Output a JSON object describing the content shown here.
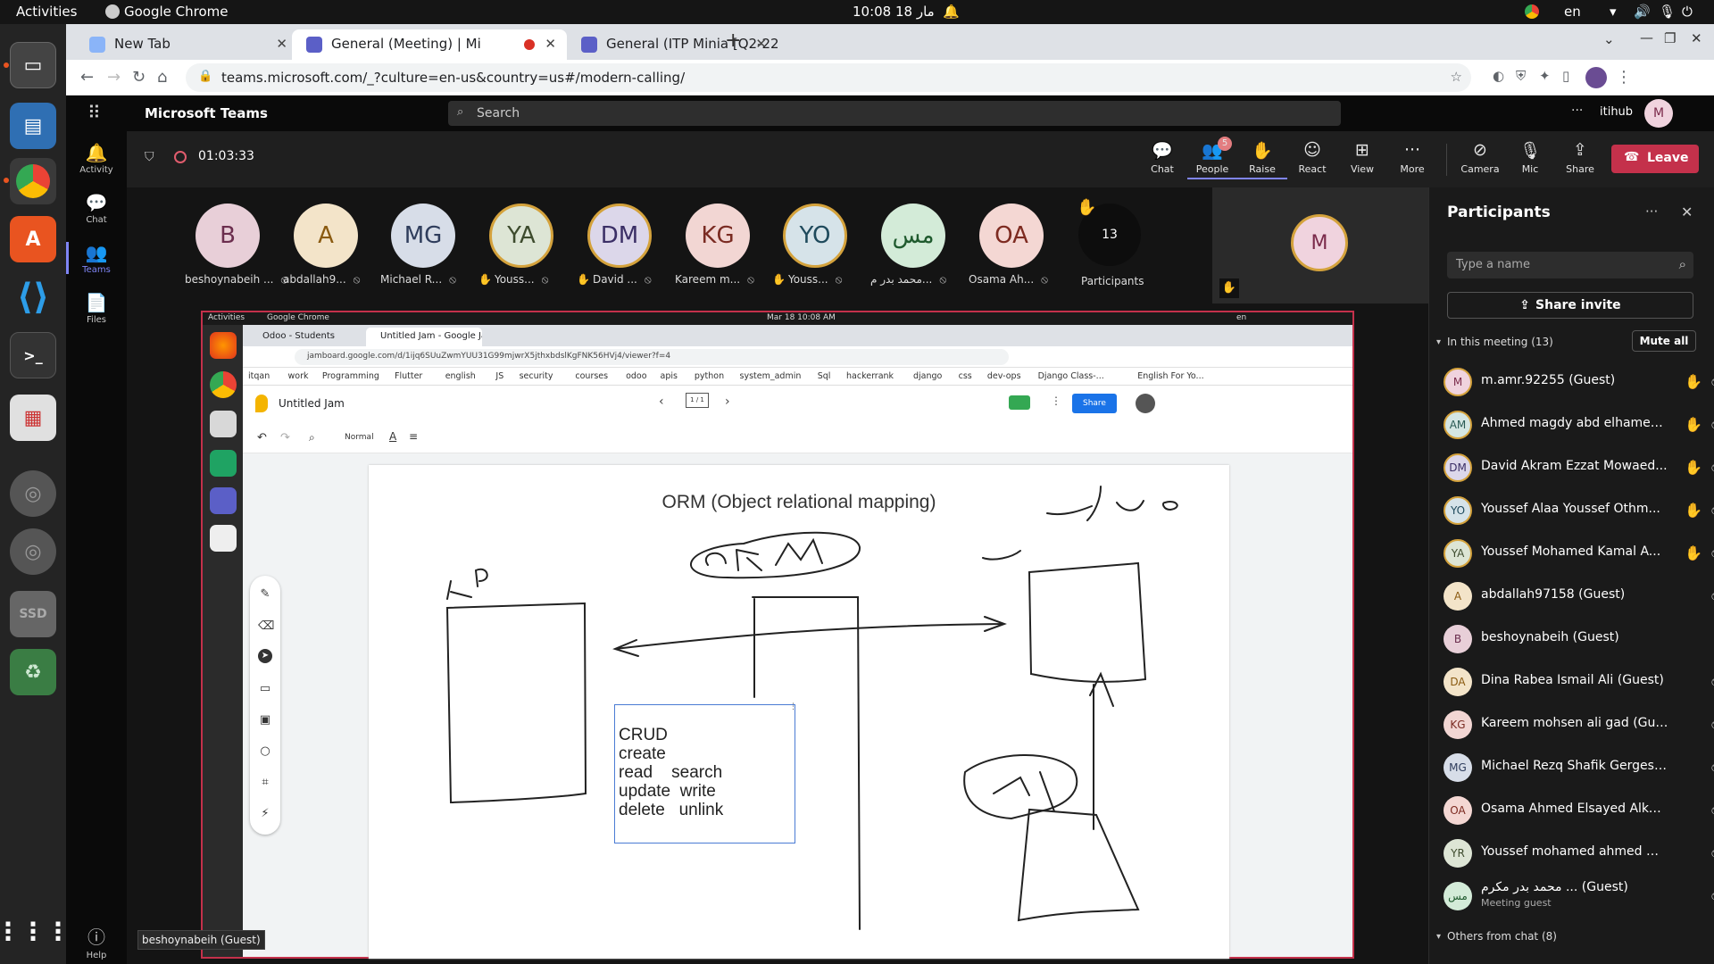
{
  "topbar": {
    "activities": "Activities",
    "app": "Google Chrome",
    "clock": "10:08  18 مار",
    "lang": "en"
  },
  "chrome": {
    "tabs": [
      {
        "title": "New Tab"
      },
      {
        "title": "General (Meeting) | Mi"
      },
      {
        "title": "General (ITP Minia [Q2-22"
      }
    ],
    "url": "teams.microsoft.com/_?culture=en-us&country=us#/modern-calling/"
  },
  "teams": {
    "brand": "Microsoft Teams",
    "search_placeholder": "Search",
    "more": "···",
    "org": "itihub",
    "me_initial": "M",
    "rail": [
      {
        "label": "Activity",
        "icon": "bell-icon"
      },
      {
        "label": "Chat",
        "icon": "chat-icon"
      },
      {
        "label": "Teams",
        "icon": "teams-icon"
      },
      {
        "label": "Files",
        "icon": "files-icon"
      },
      {
        "label": "Help",
        "icon": "help-icon"
      }
    ],
    "timer": "01:03:33",
    "controls": [
      {
        "label": "Chat",
        "icon": "chat-icon"
      },
      {
        "label": "People",
        "icon": "people-icon",
        "badge": "5"
      },
      {
        "label": "Raise",
        "icon": "hand-icon"
      },
      {
        "label": "React",
        "icon": "smile-icon"
      },
      {
        "label": "View",
        "icon": "grid-icon"
      },
      {
        "label": "More",
        "icon": "more-icon"
      },
      {
        "label": "Camera",
        "icon": "camera-off-icon"
      },
      {
        "label": "Mic",
        "icon": "mic-off-icon"
      },
      {
        "label": "Share",
        "icon": "share-icon"
      }
    ],
    "leave": "Leave",
    "gallery": [
      {
        "initials": "B",
        "name": "beshoynabeih ...",
        "bg": "#e8cfd8",
        "fg": "#6b2e4e"
      },
      {
        "initials": "A",
        "name": "abdallah9...",
        "bg": "#f3e4c9",
        "fg": "#8a5a10"
      },
      {
        "initials": "MG",
        "name": "Michael R...",
        "bg": "#d7dde8",
        "fg": "#2f3d5c"
      },
      {
        "initials": "YA",
        "name": "Youss...",
        "bg": "#dde5d5",
        "fg": "#3d4b2d",
        "hand": true
      },
      {
        "initials": "DM",
        "name": "David ...",
        "bg": "#dcd7ea",
        "fg": "#3b2f66",
        "hand": true
      },
      {
        "initials": "KG",
        "name": "Kareem m...",
        "bg": "#f2d6d3",
        "fg": "#7a2b22"
      },
      {
        "initials": "YO",
        "name": "Youss...",
        "bg": "#d6e3e9",
        "fg": "#1f4a5c",
        "hand": true
      },
      {
        "initials": "مس",
        "name": "محمد بدر م...",
        "bg": "#d3ebd8",
        "fg": "#1f5a2e"
      },
      {
        "initials": "OA",
        "name": "Osama Ah...",
        "bg": "#f4d7d3",
        "fg": "#7d2a20"
      }
    ],
    "overflow_count": "13",
    "overflow_label": "Participants",
    "tile_initial": "M",
    "hover_name": "beshoynabeih (Guest)"
  },
  "panel": {
    "title": "Participants",
    "search_placeholder": "Type a name",
    "share_invite": "Share invite",
    "in_meeting": "In this meeting (13)",
    "mute_all": "Mute all",
    "people": [
      {
        "initials": "M",
        "name": "m.amr.92255 (Guest)",
        "bg": "#f0d3de",
        "fg": "#7a2a4a",
        "hand": true,
        "mic": "off"
      },
      {
        "initials": "AM",
        "name": "Ahmed magdy abd elhamee...",
        "bg": "#d4e6e3",
        "fg": "#2a5a54",
        "hand": true,
        "mic": "off"
      },
      {
        "initials": "DM",
        "name": "David Akram Ezzat Mowaed...",
        "bg": "#dcd7ea",
        "fg": "#3b2f66",
        "hand": true,
        "mic": "off"
      },
      {
        "initials": "YO",
        "name": "Youssef Alaa Youssef Othm...",
        "bg": "#d6e3e9",
        "fg": "#1f4a5c",
        "hand": true,
        "mic": "off"
      },
      {
        "initials": "YA",
        "name": "Youssef Mohamed Kamal A...",
        "bg": "#dde5d5",
        "fg": "#3d4b2d",
        "hand": true,
        "mic": "off"
      },
      {
        "initials": "A",
        "name": "abdallah97158 (Guest)",
        "bg": "#f3e4c9",
        "fg": "#8a5a10",
        "hand": false,
        "mic": "off"
      },
      {
        "initials": "B",
        "name": "beshoynabeih (Guest)",
        "bg": "#e8cfd8",
        "fg": "#6b2e4e",
        "hand": false,
        "mic": "on"
      },
      {
        "initials": "DA",
        "name": "Dina Rabea Ismail Ali (Guest)",
        "bg": "#f3e4c9",
        "fg": "#8a5a10",
        "hand": false,
        "mic": "off"
      },
      {
        "initials": "KG",
        "name": "Kareem mohsen ali gad (Guest)",
        "bg": "#f2d6d3",
        "fg": "#7a2b22",
        "hand": false,
        "mic": "off"
      },
      {
        "initials": "MG",
        "name": "Michael Rezq Shafik Gerges (Gu...",
        "bg": "#d7dde8",
        "fg": "#2f3d5c",
        "hand": false,
        "mic": "off"
      },
      {
        "initials": "OA",
        "name": "Osama Ahmed Elsayed Alkatko...",
        "bg": "#f4d7d3",
        "fg": "#7d2a20",
        "hand": false,
        "mic": "off"
      },
      {
        "initials": "YR",
        "name": "Youssef mohamed ahmed moh...",
        "bg": "#dde5d5",
        "fg": "#3d4b2d",
        "hand": false,
        "mic": "off"
      },
      {
        "initials": "مس",
        "name": "محمد بدر مكرم ... (Guest)",
        "sub": "Meeting guest",
        "bg": "#d3ebd8",
        "fg": "#1f5a2e",
        "hand": false,
        "mic": "off"
      }
    ],
    "others": "Others from chat (8)"
  },
  "shared": {
    "os_activities": "Activities",
    "os_app": "Google Chrome",
    "os_clock": "Mar 18  10:08 AM",
    "os_lang": "en",
    "tab1": "Odoo - Students",
    "tab2": "Untitled Jam - Google Jam",
    "url": "jamboard.google.com/d/1ijq6SUuZwmYUU31G99mjwrX5jthxbdslKgFNK56HVj4/viewer?f=4",
    "bookmarks": [
      "itqan",
      "work",
      "Programming",
      "Flutter",
      "english",
      "JS",
      "security",
      "courses",
      "odoo",
      "apis",
      "python",
      "system_admin",
      "Sql",
      "hackerrank",
      "django",
      "css",
      "dev-ops",
      "Django Class-...",
      "English For Yo..."
    ],
    "jam_title": "Untitled Jam",
    "frame_counter": "1 / 1",
    "share": "Share",
    "zoom_style": "Normal",
    "board_title": "ORM (Object relational mapping)",
    "crud_lines": [
      "CRUD",
      "create",
      "read    search",
      "update  write",
      "delete   unlink"
    ]
  }
}
